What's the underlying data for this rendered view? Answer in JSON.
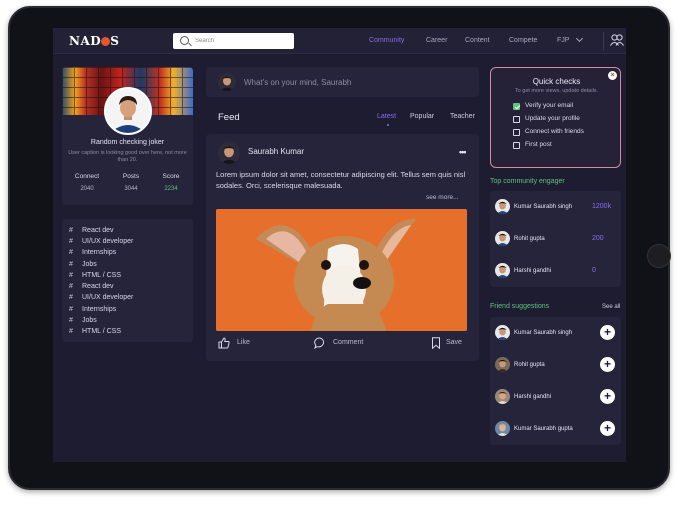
{
  "colors": {
    "accent": "#8b6cf0",
    "green": "#5fc37a",
    "bg": "#1e1c30",
    "card": "#26243b"
  },
  "navbar": {
    "logo": "NADOS",
    "search_placeholder": "Search",
    "items": [
      "Community",
      "Career",
      "Content",
      "Compete",
      "FJP"
    ],
    "active": "Community"
  },
  "profile": {
    "name": "Random checking joker",
    "caption": "User caption is looking good over here, not more than 20.",
    "stats": [
      {
        "label": "Connect",
        "value": "2040"
      },
      {
        "label": "Posts",
        "value": "3044"
      },
      {
        "label": "Score",
        "value": "2234"
      }
    ]
  },
  "tags": [
    "React dev",
    "UI/UX developer",
    "Internships",
    "Jobs",
    "HTML / CSS",
    "React dev",
    "UI/UX developer",
    "Internships",
    "Jobs",
    "HTML / CSS"
  ],
  "compose": {
    "placeholder": "What's on your mind, Saurabh"
  },
  "feed": {
    "title": "Feed",
    "tabs": [
      "Latest",
      "Popular",
      "Teacher"
    ],
    "active_tab": "Latest"
  },
  "post": {
    "author": "Saurabh Kumar",
    "more": "•••",
    "text": "Lorem ipsum dolor sit amet, consectetur adipiscing elit. Tellus sem quis nisl sodales. Orci, scelerisque malesuada.",
    "see_more": "see more...",
    "actions": {
      "like": "Like",
      "comment": "Comment",
      "save": "Save"
    }
  },
  "quick_checks": {
    "title": "Quick checks",
    "subtitle": "To get more views, update details.",
    "items": [
      {
        "label": "Verify your email",
        "checked": true
      },
      {
        "label": "Update your profile",
        "checked": false
      },
      {
        "label": "Connect with friends",
        "checked": false
      },
      {
        "label": "First post",
        "checked": false
      }
    ]
  },
  "engagers": {
    "title": "Top community engager",
    "rows": [
      {
        "name": "Kumar Saurabh singh",
        "score": "1200k"
      },
      {
        "name": "Rohit gupta",
        "score": "200"
      },
      {
        "name": "Harshi gandhi",
        "score": "0"
      }
    ]
  },
  "suggestions": {
    "title": "Friend suggestions",
    "see_all": "See all",
    "rows": [
      {
        "name": "Kumar Saurabh singh"
      },
      {
        "name": "Rohit gupta"
      },
      {
        "name": "Harshi gandhi"
      },
      {
        "name": "Kumar Saurabh gupta"
      }
    ]
  },
  "icons": [
    "search-icon",
    "chevron-down-icon",
    "users-icon",
    "close-icon",
    "more-icon",
    "like-icon",
    "comment-icon",
    "bookmark-icon",
    "plus-icon",
    "hash-icon"
  ]
}
